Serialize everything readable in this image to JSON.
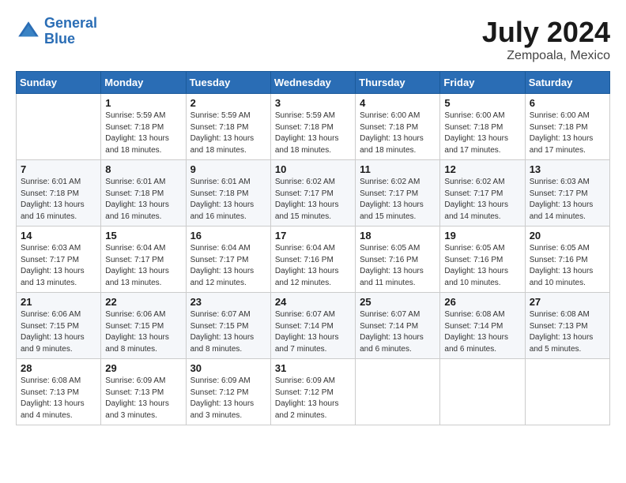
{
  "header": {
    "logo_line1": "General",
    "logo_line2": "Blue",
    "month_year": "July 2024",
    "location": "Zempoala, Mexico"
  },
  "weekdays": [
    "Sunday",
    "Monday",
    "Tuesday",
    "Wednesday",
    "Thursday",
    "Friday",
    "Saturday"
  ],
  "weeks": [
    [
      {
        "day": "",
        "sunrise": "",
        "sunset": "",
        "daylight": ""
      },
      {
        "day": "1",
        "sunrise": "Sunrise: 5:59 AM",
        "sunset": "Sunset: 7:18 PM",
        "daylight": "Daylight: 13 hours and 18 minutes."
      },
      {
        "day": "2",
        "sunrise": "Sunrise: 5:59 AM",
        "sunset": "Sunset: 7:18 PM",
        "daylight": "Daylight: 13 hours and 18 minutes."
      },
      {
        "day": "3",
        "sunrise": "Sunrise: 5:59 AM",
        "sunset": "Sunset: 7:18 PM",
        "daylight": "Daylight: 13 hours and 18 minutes."
      },
      {
        "day": "4",
        "sunrise": "Sunrise: 6:00 AM",
        "sunset": "Sunset: 7:18 PM",
        "daylight": "Daylight: 13 hours and 18 minutes."
      },
      {
        "day": "5",
        "sunrise": "Sunrise: 6:00 AM",
        "sunset": "Sunset: 7:18 PM",
        "daylight": "Daylight: 13 hours and 17 minutes."
      },
      {
        "day": "6",
        "sunrise": "Sunrise: 6:00 AM",
        "sunset": "Sunset: 7:18 PM",
        "daylight": "Daylight: 13 hours and 17 minutes."
      }
    ],
    [
      {
        "day": "7",
        "sunrise": "Sunrise: 6:01 AM",
        "sunset": "Sunset: 7:18 PM",
        "daylight": "Daylight: 13 hours and 16 minutes."
      },
      {
        "day": "8",
        "sunrise": "Sunrise: 6:01 AM",
        "sunset": "Sunset: 7:18 PM",
        "daylight": "Daylight: 13 hours and 16 minutes."
      },
      {
        "day": "9",
        "sunrise": "Sunrise: 6:01 AM",
        "sunset": "Sunset: 7:18 PM",
        "daylight": "Daylight: 13 hours and 16 minutes."
      },
      {
        "day": "10",
        "sunrise": "Sunrise: 6:02 AM",
        "sunset": "Sunset: 7:17 PM",
        "daylight": "Daylight: 13 hours and 15 minutes."
      },
      {
        "day": "11",
        "sunrise": "Sunrise: 6:02 AM",
        "sunset": "Sunset: 7:17 PM",
        "daylight": "Daylight: 13 hours and 15 minutes."
      },
      {
        "day": "12",
        "sunrise": "Sunrise: 6:02 AM",
        "sunset": "Sunset: 7:17 PM",
        "daylight": "Daylight: 13 hours and 14 minutes."
      },
      {
        "day": "13",
        "sunrise": "Sunrise: 6:03 AM",
        "sunset": "Sunset: 7:17 PM",
        "daylight": "Daylight: 13 hours and 14 minutes."
      }
    ],
    [
      {
        "day": "14",
        "sunrise": "Sunrise: 6:03 AM",
        "sunset": "Sunset: 7:17 PM",
        "daylight": "Daylight: 13 hours and 13 minutes."
      },
      {
        "day": "15",
        "sunrise": "Sunrise: 6:04 AM",
        "sunset": "Sunset: 7:17 PM",
        "daylight": "Daylight: 13 hours and 13 minutes."
      },
      {
        "day": "16",
        "sunrise": "Sunrise: 6:04 AM",
        "sunset": "Sunset: 7:17 PM",
        "daylight": "Daylight: 13 hours and 12 minutes."
      },
      {
        "day": "17",
        "sunrise": "Sunrise: 6:04 AM",
        "sunset": "Sunset: 7:16 PM",
        "daylight": "Daylight: 13 hours and 12 minutes."
      },
      {
        "day": "18",
        "sunrise": "Sunrise: 6:05 AM",
        "sunset": "Sunset: 7:16 PM",
        "daylight": "Daylight: 13 hours and 11 minutes."
      },
      {
        "day": "19",
        "sunrise": "Sunrise: 6:05 AM",
        "sunset": "Sunset: 7:16 PM",
        "daylight": "Daylight: 13 hours and 10 minutes."
      },
      {
        "day": "20",
        "sunrise": "Sunrise: 6:05 AM",
        "sunset": "Sunset: 7:16 PM",
        "daylight": "Daylight: 13 hours and 10 minutes."
      }
    ],
    [
      {
        "day": "21",
        "sunrise": "Sunrise: 6:06 AM",
        "sunset": "Sunset: 7:15 PM",
        "daylight": "Daylight: 13 hours and 9 minutes."
      },
      {
        "day": "22",
        "sunrise": "Sunrise: 6:06 AM",
        "sunset": "Sunset: 7:15 PM",
        "daylight": "Daylight: 13 hours and 8 minutes."
      },
      {
        "day": "23",
        "sunrise": "Sunrise: 6:07 AM",
        "sunset": "Sunset: 7:15 PM",
        "daylight": "Daylight: 13 hours and 8 minutes."
      },
      {
        "day": "24",
        "sunrise": "Sunrise: 6:07 AM",
        "sunset": "Sunset: 7:14 PM",
        "daylight": "Daylight: 13 hours and 7 minutes."
      },
      {
        "day": "25",
        "sunrise": "Sunrise: 6:07 AM",
        "sunset": "Sunset: 7:14 PM",
        "daylight": "Daylight: 13 hours and 6 minutes."
      },
      {
        "day": "26",
        "sunrise": "Sunrise: 6:08 AM",
        "sunset": "Sunset: 7:14 PM",
        "daylight": "Daylight: 13 hours and 6 minutes."
      },
      {
        "day": "27",
        "sunrise": "Sunrise: 6:08 AM",
        "sunset": "Sunset: 7:13 PM",
        "daylight": "Daylight: 13 hours and 5 minutes."
      }
    ],
    [
      {
        "day": "28",
        "sunrise": "Sunrise: 6:08 AM",
        "sunset": "Sunset: 7:13 PM",
        "daylight": "Daylight: 13 hours and 4 minutes."
      },
      {
        "day": "29",
        "sunrise": "Sunrise: 6:09 AM",
        "sunset": "Sunset: 7:13 PM",
        "daylight": "Daylight: 13 hours and 3 minutes."
      },
      {
        "day": "30",
        "sunrise": "Sunrise: 6:09 AM",
        "sunset": "Sunset: 7:12 PM",
        "daylight": "Daylight: 13 hours and 3 minutes."
      },
      {
        "day": "31",
        "sunrise": "Sunrise: 6:09 AM",
        "sunset": "Sunset: 7:12 PM",
        "daylight": "Daylight: 13 hours and 2 minutes."
      },
      {
        "day": "",
        "sunrise": "",
        "sunset": "",
        "daylight": ""
      },
      {
        "day": "",
        "sunrise": "",
        "sunset": "",
        "daylight": ""
      },
      {
        "day": "",
        "sunrise": "",
        "sunset": "",
        "daylight": ""
      }
    ]
  ]
}
